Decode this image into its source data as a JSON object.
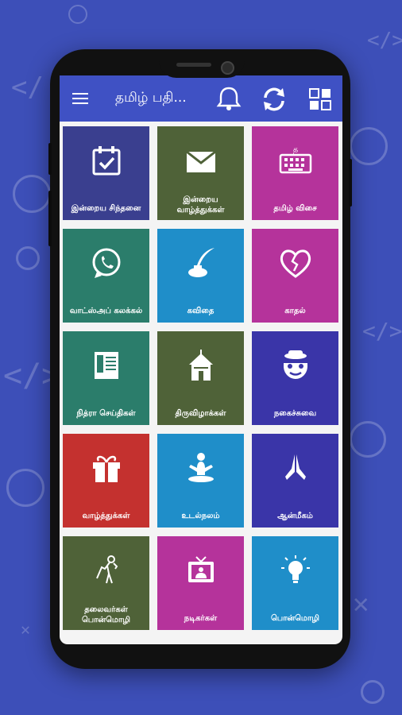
{
  "app": {
    "title": "தமிழ் பதி..."
  },
  "colors": {
    "background": "#3d4fb8",
    "appbar": "#3f51c4",
    "navy": "#3a3f8f",
    "olive": "#4f6238",
    "magenta": "#b5339b",
    "teal": "#2b7d6b",
    "blue": "#1f8ec9",
    "red": "#c4312f",
    "indigo": "#3a35a8"
  },
  "tiles": [
    {
      "label": "இன்றைய சிந்தனை",
      "icon": "calendar-check-icon"
    },
    {
      "label": "இன்றைய வாழ்த்துக்கள்",
      "icon": "envelope-icon"
    },
    {
      "label": "தமிழ் விசை",
      "icon": "keyboard-icon"
    },
    {
      "label": "வாட்ஸ்அப் கலக்கல்",
      "icon": "whatsapp-icon"
    },
    {
      "label": "கவிதை",
      "icon": "quill-inkpot-icon"
    },
    {
      "label": "காதல்",
      "icon": "broken-heart-icon"
    },
    {
      "label": "நித்ரா செய்திகள்",
      "icon": "newspaper-icon"
    },
    {
      "label": "திருவிழாக்கள்",
      "icon": "temple-icon"
    },
    {
      "label": "நகைச்சுவை",
      "icon": "funny-face-icon"
    },
    {
      "label": "வாழ்த்துக்கள்",
      "icon": "gift-icon"
    },
    {
      "label": "உடல்நலம்",
      "icon": "yoga-icon"
    },
    {
      "label": "ஆன்மீகம்",
      "icon": "praying-hands-icon"
    },
    {
      "label": "தலைவர்கள் பொன்மொழி",
      "icon": "leader-statue-icon"
    },
    {
      "label": "நடிகர்கள்",
      "icon": "tv-actor-icon"
    },
    {
      "label": "பொன்மொழி",
      "icon": "lightbulb-icon"
    }
  ]
}
